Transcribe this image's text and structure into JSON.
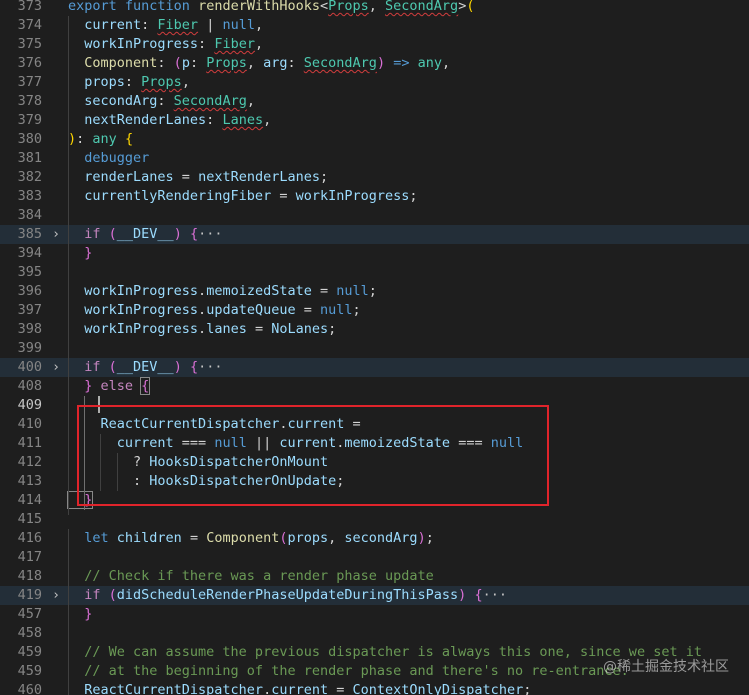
{
  "editor": {
    "watermark": "@稀土掘金技术社区",
    "lines": [
      {
        "n": "373",
        "tokens": [
          {
            "t": "export ",
            "c": "kw"
          },
          {
            "t": "function ",
            "c": "kw"
          },
          {
            "t": "renderWithHooks",
            "c": "fn"
          },
          {
            "t": "<",
            "c": "pun"
          },
          {
            "t": "Props",
            "c": "type",
            "sq": true
          },
          {
            "t": ", ",
            "c": "pun"
          },
          {
            "t": "SecondArg",
            "c": "type",
            "sq": true
          },
          {
            "t": ">",
            "c": "pun"
          },
          {
            "t": "(",
            "c": "b1"
          }
        ]
      },
      {
        "n": "374",
        "tokens": [
          {
            "t": "  current",
            "c": "var"
          },
          {
            "t": ": ",
            "c": "pun"
          },
          {
            "t": "Fiber",
            "c": "type",
            "sq": true
          },
          {
            "t": " | ",
            "c": "pun"
          },
          {
            "t": "null",
            "c": "kw"
          },
          {
            "t": ",",
            "c": "pun"
          }
        ]
      },
      {
        "n": "375",
        "tokens": [
          {
            "t": "  workInProgress",
            "c": "var"
          },
          {
            "t": ": ",
            "c": "pun"
          },
          {
            "t": "Fiber",
            "c": "type",
            "sq": true
          },
          {
            "t": ",",
            "c": "pun"
          }
        ]
      },
      {
        "n": "376",
        "tokens": [
          {
            "t": "  Component",
            "c": "fn"
          },
          {
            "t": ": ",
            "c": "pun"
          },
          {
            "t": "(",
            "c": "b2"
          },
          {
            "t": "p",
            "c": "var"
          },
          {
            "t": ": ",
            "c": "pun"
          },
          {
            "t": "Props",
            "c": "type",
            "sq": true
          },
          {
            "t": ", ",
            "c": "pun"
          },
          {
            "t": "arg",
            "c": "var"
          },
          {
            "t": ": ",
            "c": "pun"
          },
          {
            "t": "SecondArg",
            "c": "type",
            "sq": true
          },
          {
            "t": ")",
            "c": "b2"
          },
          {
            "t": " => ",
            "c": "kw"
          },
          {
            "t": "any",
            "c": "type"
          },
          {
            "t": ",",
            "c": "pun"
          }
        ]
      },
      {
        "n": "377",
        "tokens": [
          {
            "t": "  props",
            "c": "var"
          },
          {
            "t": ": ",
            "c": "pun"
          },
          {
            "t": "Props",
            "c": "type",
            "sq": true
          },
          {
            "t": ",",
            "c": "pun"
          }
        ]
      },
      {
        "n": "378",
        "tokens": [
          {
            "t": "  secondArg",
            "c": "var"
          },
          {
            "t": ": ",
            "c": "pun"
          },
          {
            "t": "SecondArg",
            "c": "type",
            "sq": true
          },
          {
            "t": ",",
            "c": "pun"
          }
        ]
      },
      {
        "n": "379",
        "tokens": [
          {
            "t": "  nextRenderLanes",
            "c": "var"
          },
          {
            "t": ": ",
            "c": "pun"
          },
          {
            "t": "Lanes",
            "c": "type",
            "sq": true
          },
          {
            "t": ",",
            "c": "pun"
          }
        ]
      },
      {
        "n": "380",
        "tokens": [
          {
            "t": ")",
            "c": "b1"
          },
          {
            "t": ": ",
            "c": "pun"
          },
          {
            "t": "any",
            "c": "type"
          },
          {
            "t": " ",
            "c": "pun"
          },
          {
            "t": "{",
            "c": "b1"
          }
        ]
      },
      {
        "n": "381",
        "tokens": [
          {
            "t": "  debugger",
            "c": "kw"
          }
        ]
      },
      {
        "n": "382",
        "tokens": [
          {
            "t": "  renderLanes",
            "c": "var"
          },
          {
            "t": " = ",
            "c": "pun"
          },
          {
            "t": "nextRenderLanes",
            "c": "var"
          },
          {
            "t": ";",
            "c": "pun"
          }
        ]
      },
      {
        "n": "383",
        "tokens": [
          {
            "t": "  currentlyRenderingFiber",
            "c": "var"
          },
          {
            "t": " = ",
            "c": "pun"
          },
          {
            "t": "workInProgress",
            "c": "var"
          },
          {
            "t": ";",
            "c": "pun"
          }
        ]
      },
      {
        "n": "384",
        "tokens": []
      },
      {
        "n": "385",
        "fold": true,
        "tokens": [
          {
            "t": "  if ",
            "c": "ctl"
          },
          {
            "t": "(",
            "c": "b2"
          },
          {
            "t": "__DEV__",
            "c": "var"
          },
          {
            "t": ")",
            "c": "b2"
          },
          {
            "t": " ",
            "c": "pun"
          },
          {
            "t": "{",
            "c": "b2"
          },
          {
            "t": "···",
            "c": "fold"
          }
        ]
      },
      {
        "n": "394",
        "tokens": [
          {
            "t": "  }",
            "c": "b2"
          }
        ]
      },
      {
        "n": "395",
        "tokens": []
      },
      {
        "n": "396",
        "tokens": [
          {
            "t": "  workInProgress",
            "c": "var"
          },
          {
            "t": ".",
            "c": "pun"
          },
          {
            "t": "memoizedState",
            "c": "var"
          },
          {
            "t": " = ",
            "c": "pun"
          },
          {
            "t": "null",
            "c": "kw"
          },
          {
            "t": ";",
            "c": "pun"
          }
        ]
      },
      {
        "n": "397",
        "tokens": [
          {
            "t": "  workInProgress",
            "c": "var"
          },
          {
            "t": ".",
            "c": "pun"
          },
          {
            "t": "updateQueue",
            "c": "var"
          },
          {
            "t": " = ",
            "c": "pun"
          },
          {
            "t": "null",
            "c": "kw"
          },
          {
            "t": ";",
            "c": "pun"
          }
        ]
      },
      {
        "n": "398",
        "tokens": [
          {
            "t": "  workInProgress",
            "c": "var"
          },
          {
            "t": ".",
            "c": "pun"
          },
          {
            "t": "lanes",
            "c": "var"
          },
          {
            "t": " = ",
            "c": "pun"
          },
          {
            "t": "NoLanes",
            "c": "var"
          },
          {
            "t": ";",
            "c": "pun"
          }
        ]
      },
      {
        "n": "399",
        "tokens": []
      },
      {
        "n": "400",
        "fold": true,
        "tokens": [
          {
            "t": "  if ",
            "c": "ctl"
          },
          {
            "t": "(",
            "c": "b2"
          },
          {
            "t": "__DEV__",
            "c": "var"
          },
          {
            "t": ")",
            "c": "b2"
          },
          {
            "t": " ",
            "c": "pun"
          },
          {
            "t": "{",
            "c": "b2"
          },
          {
            "t": "···",
            "c": "fold"
          }
        ]
      },
      {
        "n": "408",
        "tokens": [
          {
            "t": "  }",
            "c": "b2"
          },
          {
            "t": " else ",
            "c": "ctl"
          },
          {
            "t": "{",
            "c": "b2",
            "match": true
          }
        ]
      },
      {
        "n": "409",
        "active": true,
        "tokens": []
      },
      {
        "n": "410",
        "tokens": [
          {
            "t": "    ReactCurrentDispatcher",
            "c": "var"
          },
          {
            "t": ".",
            "c": "pun"
          },
          {
            "t": "current",
            "c": "var"
          },
          {
            "t": " =",
            "c": "pun"
          }
        ]
      },
      {
        "n": "411",
        "tokens": [
          {
            "t": "      current",
            "c": "var"
          },
          {
            "t": " === ",
            "c": "pun"
          },
          {
            "t": "null",
            "c": "kw"
          },
          {
            "t": " || ",
            "c": "pun"
          },
          {
            "t": "current",
            "c": "var"
          },
          {
            "t": ".",
            "c": "pun"
          },
          {
            "t": "memoizedState",
            "c": "var"
          },
          {
            "t": " === ",
            "c": "pun"
          },
          {
            "t": "null",
            "c": "kw"
          }
        ]
      },
      {
        "n": "412",
        "tokens": [
          {
            "t": "        ? ",
            "c": "pun"
          },
          {
            "t": "HooksDispatcherOnMount",
            "c": "var"
          }
        ]
      },
      {
        "n": "413",
        "tokens": [
          {
            "t": "        : ",
            "c": "pun"
          },
          {
            "t": "HooksDispatcherOnUpdate",
            "c": "var"
          },
          {
            "t": ";",
            "c": "pun"
          }
        ]
      },
      {
        "n": "414",
        "tokens": [
          {
            "t": "  }",
            "c": "b2",
            "match": true
          }
        ]
      },
      {
        "n": "415",
        "tokens": []
      },
      {
        "n": "416",
        "tokens": [
          {
            "t": "  let ",
            "c": "kw"
          },
          {
            "t": "children",
            "c": "var"
          },
          {
            "t": " = ",
            "c": "pun"
          },
          {
            "t": "Component",
            "c": "fn"
          },
          {
            "t": "(",
            "c": "b2"
          },
          {
            "t": "props",
            "c": "var"
          },
          {
            "t": ", ",
            "c": "pun"
          },
          {
            "t": "secondArg",
            "c": "var"
          },
          {
            "t": ")",
            "c": "b2"
          },
          {
            "t": ";",
            "c": "pun"
          }
        ]
      },
      {
        "n": "417",
        "tokens": []
      },
      {
        "n": "418",
        "tokens": [
          {
            "t": "  // Check if there was a render phase update",
            "c": "cmt"
          }
        ]
      },
      {
        "n": "419",
        "fold": true,
        "tokens": [
          {
            "t": "  if ",
            "c": "ctl"
          },
          {
            "t": "(",
            "c": "b2"
          },
          {
            "t": "didScheduleRenderPhaseUpdateDuringThisPass",
            "c": "var"
          },
          {
            "t": ")",
            "c": "b2"
          },
          {
            "t": " ",
            "c": "pun"
          },
          {
            "t": "{",
            "c": "b2"
          },
          {
            "t": "···",
            "c": "fold"
          }
        ]
      },
      {
        "n": "457",
        "tokens": [
          {
            "t": "  }",
            "c": "b2"
          }
        ]
      },
      {
        "n": "458",
        "tokens": []
      },
      {
        "n": "459",
        "tokens": [
          {
            "t": "  // We can assume the previous dispatcher is always this one, since we set it",
            "c": "cmt"
          }
        ]
      },
      {
        "n": "459",
        "tokens": [
          {
            "t": "  // at the beginning of the render phase and there's no re-entrance.",
            "c": "cmt"
          }
        ]
      },
      {
        "n": "460",
        "tokens": [
          {
            "t": "  ReactCurrentDispatcher",
            "c": "var"
          },
          {
            "t": ".",
            "c": "pun"
          },
          {
            "t": "current",
            "c": "var"
          },
          {
            "t": " = ",
            "c": "pun"
          },
          {
            "t": "ContextOnlyDispatcher",
            "c": "var"
          },
          {
            "t": ";",
            "c": "pun"
          }
        ]
      }
    ]
  }
}
